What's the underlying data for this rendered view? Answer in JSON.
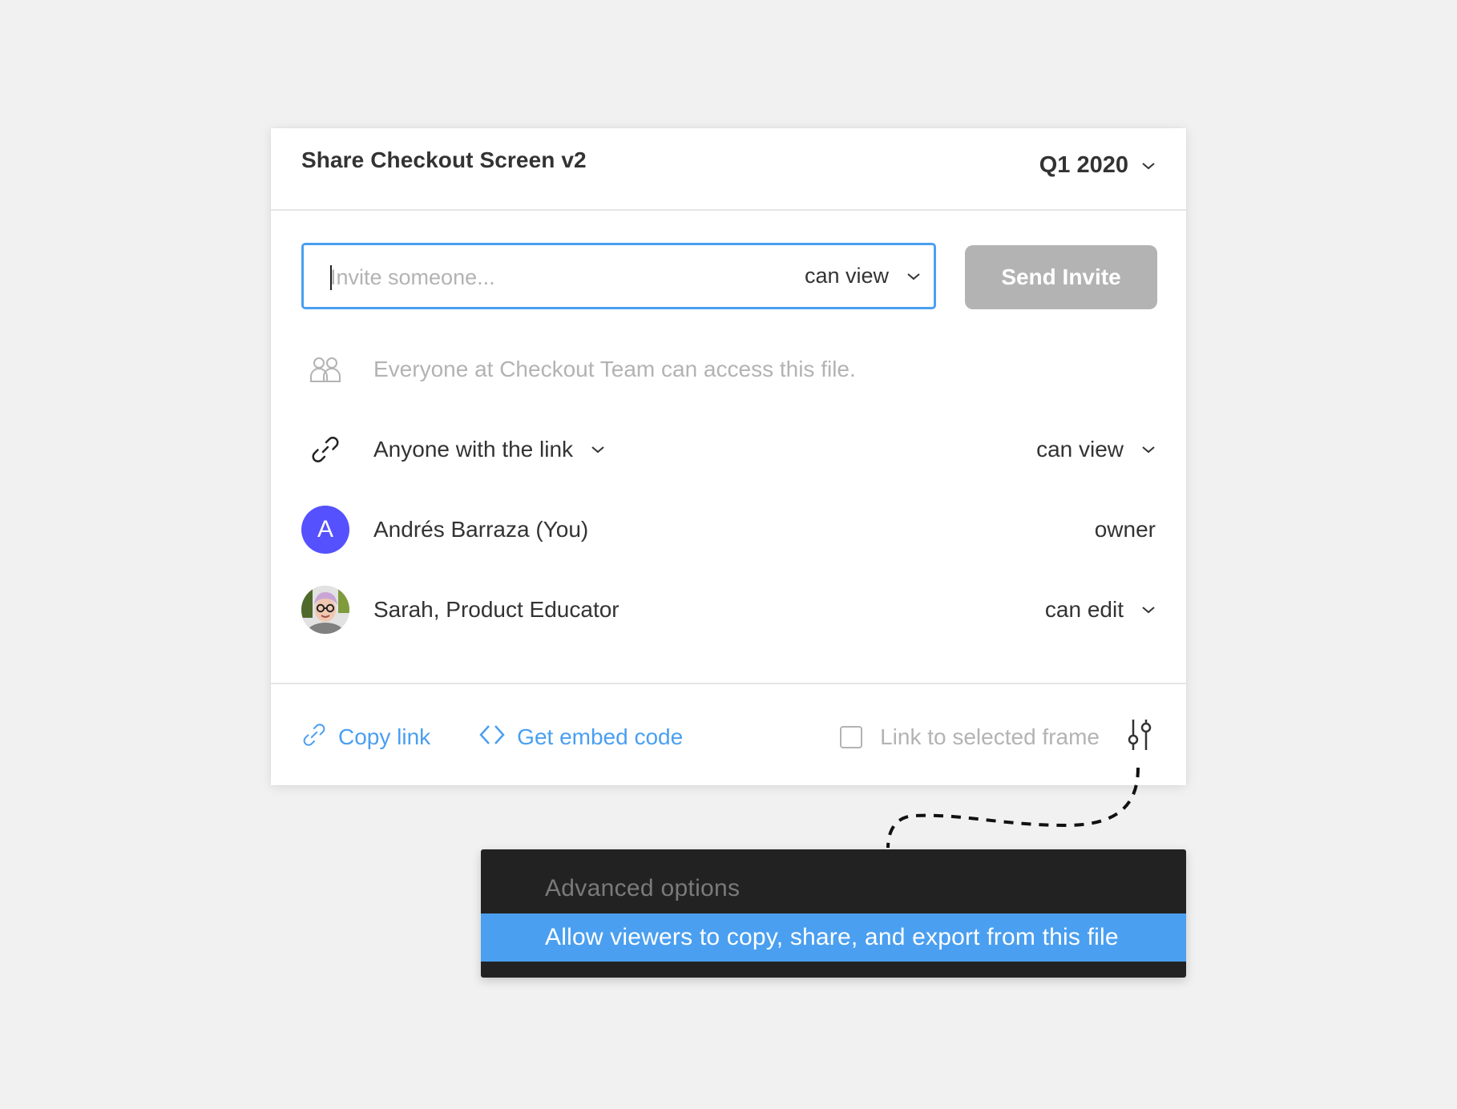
{
  "dialog": {
    "title_prefix": "Share",
    "title_rest": " Checkout Screen v2",
    "period_selector": "Q1 2020"
  },
  "invite": {
    "placeholder": "Invite someone...",
    "value": "",
    "permission": "can view",
    "send_button": "Send Invite"
  },
  "team_notice": "Everyone at Checkout Team can access this file.",
  "link_access": {
    "scope": "Anyone with the link",
    "permission": "can view"
  },
  "members": [
    {
      "initial": "A",
      "name": "Andrés Barraza (You)",
      "role": "owner",
      "avatar_color": "#5551FF"
    },
    {
      "name": "Sarah, Product Educator",
      "role": "can edit",
      "avatar": "photo"
    }
  ],
  "footer": {
    "copy_link": "Copy link",
    "embed_code": "Get embed code",
    "link_to_frame": "Link to selected frame",
    "link_to_frame_checked": false
  },
  "advanced_menu": {
    "header": "Advanced options",
    "item": "Allow viewers to copy, share, and export from this file"
  },
  "colors": {
    "accent": "#4A9FF0",
    "disabled_button": "#B3B3B3",
    "avatar": "#5551FF",
    "menu_bg": "#222222",
    "page_bg": "#F1F1F1"
  },
  "icons": {
    "period_chevron": "chevron-down-icon",
    "team": "team-people-icon",
    "link": "link-icon",
    "embed": "code-brackets-icon",
    "settings": "sliders-icon"
  }
}
